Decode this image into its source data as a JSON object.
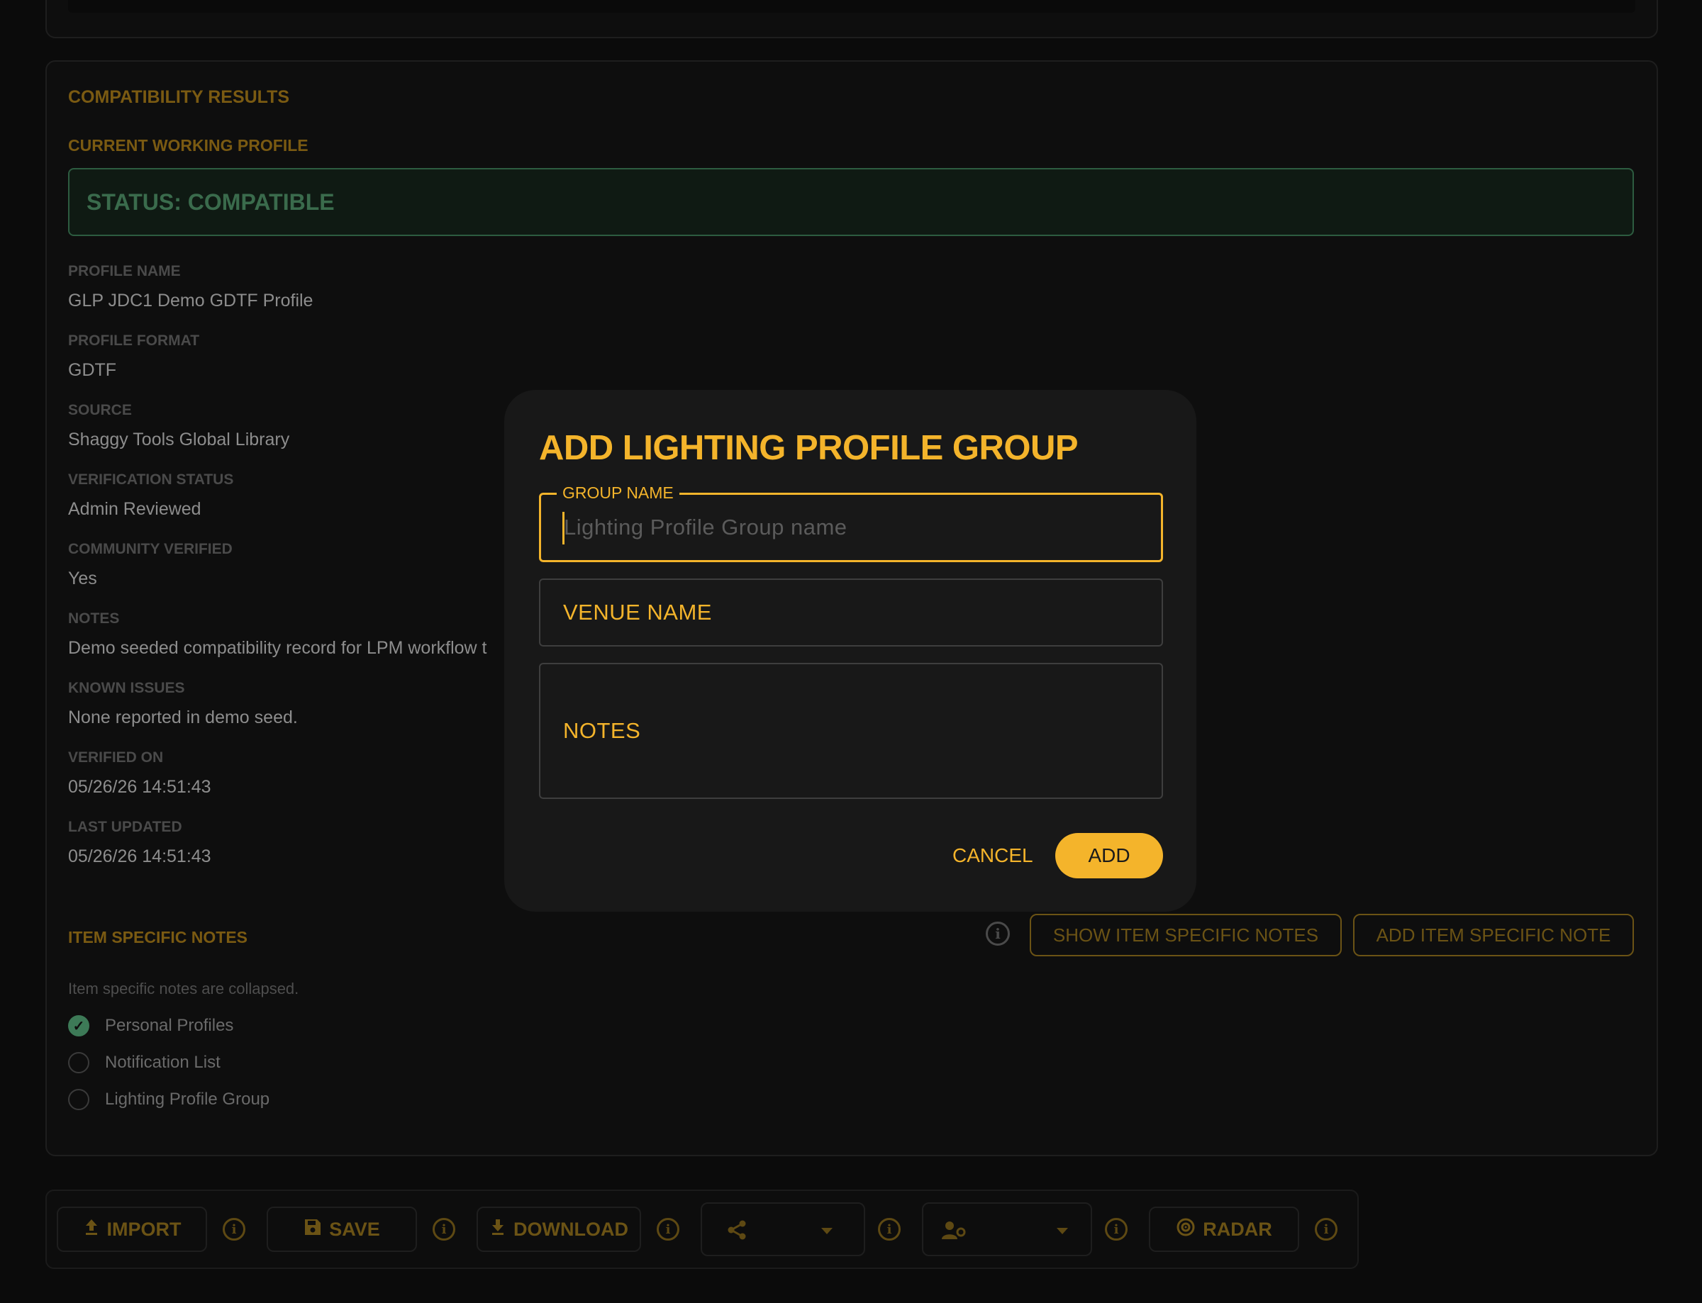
{
  "results": {
    "section_title": "COMPATIBILITY RESULTS",
    "current_profile_label": "CURRENT WORKING PROFILE",
    "status": "STATUS: COMPATIBLE",
    "fields": [
      {
        "label": "PROFILE NAME",
        "value": "GLP JDC1 Demo GDTF Profile"
      },
      {
        "label": "PROFILE FORMAT",
        "value": "GDTF"
      },
      {
        "label": "SOURCE",
        "value": "Shaggy Tools Global Library"
      },
      {
        "label": "VERIFICATION STATUS",
        "value": "Admin Reviewed"
      },
      {
        "label": "COMMUNITY VERIFIED",
        "value": "Yes"
      },
      {
        "label": "NOTES",
        "value": "Demo seeded compatibility record for LPM workflow t"
      },
      {
        "label": "KNOWN ISSUES",
        "value": "None reported in demo seed."
      },
      {
        "label": "VERIFIED ON",
        "value": "05/26/26 14:51:43"
      },
      {
        "label": "LAST UPDATED",
        "value": "05/26/26 14:51:43"
      }
    ]
  },
  "item_notes": {
    "title": "ITEM SPECIFIC NOTES",
    "show_button": "SHOW ITEM SPECIFIC NOTES",
    "add_button": "ADD ITEM SPECIFIC NOTE",
    "collapsed_text": "Item specific notes are collapsed.",
    "lists": [
      {
        "label": "Personal Profiles",
        "checked": true
      },
      {
        "label": "Notification List",
        "checked": false
      },
      {
        "label": "Lighting Profile Group",
        "checked": false
      }
    ]
  },
  "toolbar": {
    "import": "IMPORT",
    "save": "SAVE",
    "download": "DOWNLOAD",
    "radar": "RADAR"
  },
  "dialog": {
    "title": "ADD LIGHTING PROFILE GROUP",
    "group_name_label": "GROUP NAME",
    "group_name_placeholder": "Lighting Profile Group name",
    "venue_name_label": "VENUE NAME",
    "notes_label": "NOTES",
    "cancel": "CANCEL",
    "add": "ADD"
  },
  "colors": {
    "accent": "#f4b42b",
    "status_green": "#3a6b4c",
    "background": "#0b0b0b",
    "dialog_bg": "#181818"
  }
}
